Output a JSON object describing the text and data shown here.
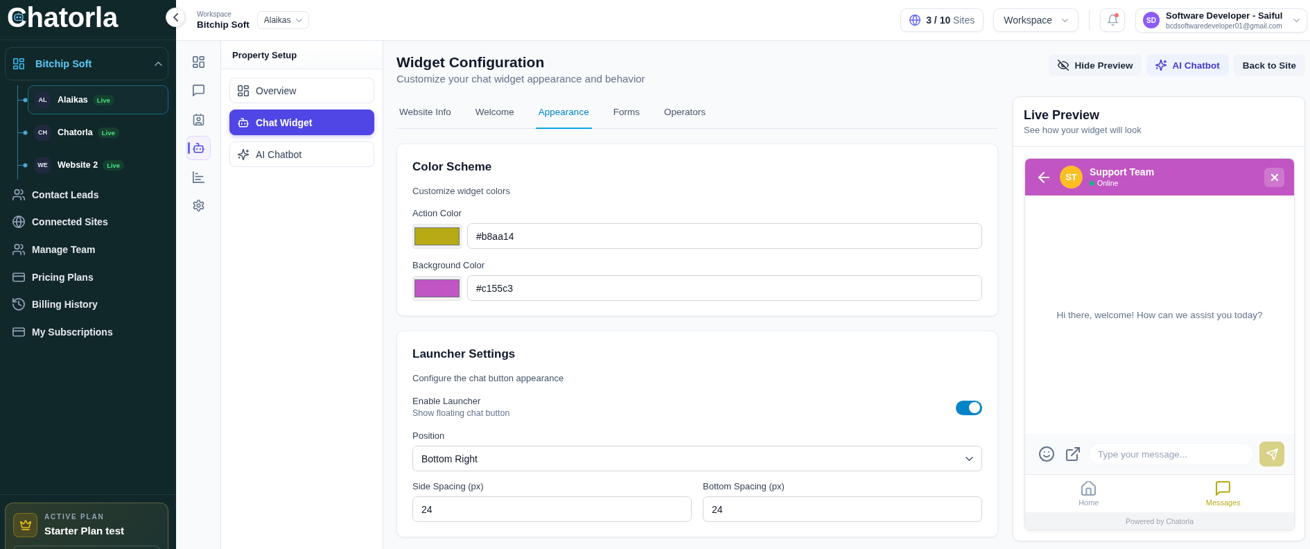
{
  "sidebar": {
    "logo": "Chatorla",
    "workspace": {
      "name": "Bitchip Soft",
      "expanded": true,
      "sites": [
        {
          "initials": "AL",
          "name": "Alaikas",
          "status": "Live",
          "selected": true
        },
        {
          "initials": "CH",
          "name": "Chatorla",
          "status": "Live",
          "selected": false
        },
        {
          "initials": "WE",
          "name": "Website 2",
          "status": "Live",
          "selected": false
        }
      ]
    },
    "nav": [
      {
        "label": "Contact Leads",
        "selected": false
      },
      {
        "label": "Connected Sites",
        "selected": false
      },
      {
        "label": "Manage Team",
        "selected": false
      },
      {
        "label": "Pricing Plans",
        "selected": false
      },
      {
        "label": "Billing History",
        "selected": false
      },
      {
        "label": "My Subscriptions",
        "selected": false
      }
    ],
    "plan": {
      "caption": "ACTIVE PLAN",
      "name": "Starter Plan test"
    }
  },
  "topbar": {
    "workspace_caption": "Workspace",
    "workspace_name": "Bitchip Soft",
    "site_select": "Alaikas",
    "sites_usage": "**3 / 10** Sites",
    "workspace_menu": "Workspace",
    "notifications": {
      "unread": true
    },
    "user": {
      "initials": "SD",
      "name": "Software Developer - Saiful",
      "email": "bcdsoftwaredeveloper01@gmail.com"
    }
  },
  "icon_rail": [
    {
      "selected": false
    },
    {
      "selected": false
    },
    {
      "selected": false
    },
    {
      "selected": true
    },
    {
      "selected": false
    },
    {
      "selected": false
    }
  ],
  "property_setup": {
    "title": "Property Setup",
    "items": [
      {
        "label": "Overview",
        "selected": false
      },
      {
        "label": "Chat Widget",
        "selected": true
      },
      {
        "label": "AI Chatbot",
        "selected": false
      }
    ]
  },
  "main": {
    "title": "Widget Configuration",
    "subtitle": "Customize your chat widget appearance and behavior",
    "actions": [
      {
        "label": "Hide Preview",
        "kind": "plain"
      },
      {
        "label": "AI Chatbot",
        "kind": "accent"
      },
      {
        "label": "Back to Site",
        "kind": "plain"
      }
    ],
    "tabs": [
      {
        "label": "Website Info",
        "selected": false
      },
      {
        "label": "Welcome",
        "selected": false
      },
      {
        "label": "Appearance",
        "selected": true
      },
      {
        "label": "Forms",
        "selected": false
      },
      {
        "label": "Operators",
        "selected": false
      }
    ],
    "color_scheme": {
      "title": "Color Scheme",
      "description": "Customize widget colors",
      "fields": [
        {
          "label": "Action Color",
          "value": "#b8aa14",
          "color": "#b8aa14"
        },
        {
          "label": "Background Color",
          "value": "#c155c3",
          "color": "#c155c3"
        }
      ]
    },
    "launcher": {
      "title": "Launcher Settings",
      "description": "Configure the chat button appearance",
      "enable": {
        "label": "Enable Launcher",
        "hint": "Show floating chat button",
        "on": true
      },
      "position": {
        "label": "Position",
        "value": "Bottom Right"
      },
      "spacing": [
        {
          "label": "Side Spacing (px)",
          "value": "24"
        },
        {
          "label": "Bottom Spacing (px)",
          "value": "24"
        }
      ]
    }
  },
  "preview": {
    "title": "Live Preview",
    "subtitle": "See how your widget will look",
    "widget": {
      "avatar": "ST",
      "name": "Support Team",
      "status": "Online",
      "online": true,
      "welcome": "Hi there, welcome! How can we assist you today?",
      "placeholder": "Type your message...",
      "nav": [
        {
          "label": "Home",
          "selected": false
        },
        {
          "label": "Messages",
          "selected": true
        }
      ],
      "footer": "Powered by Chatorla"
    }
  }
}
